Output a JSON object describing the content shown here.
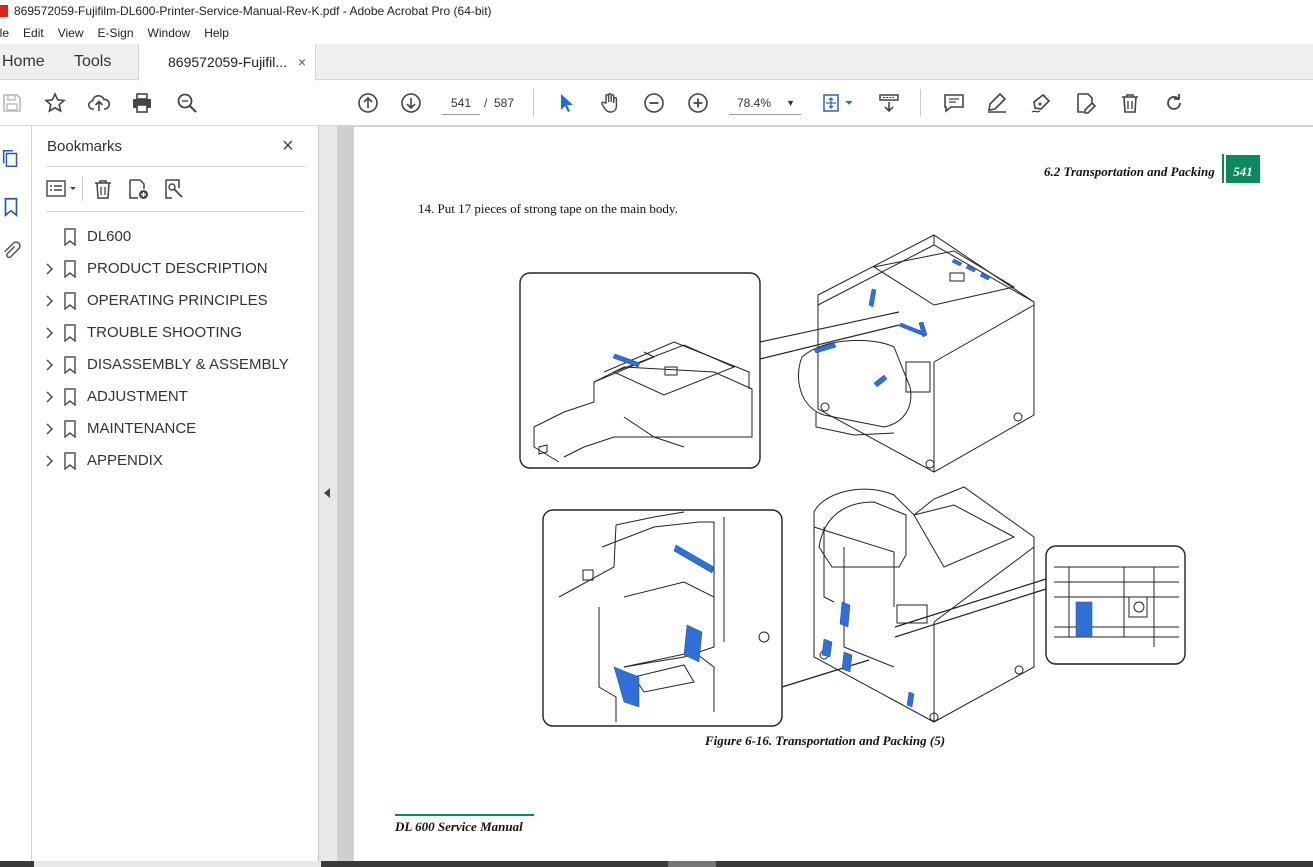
{
  "window": {
    "title": "869572059-Fujifilm-DL600-Printer-Service-Manual-Rev-K.pdf - Adobe Acrobat Pro (64-bit)"
  },
  "menu": [
    "ile",
    "Edit",
    "View",
    "E-Sign",
    "Window",
    "Help"
  ],
  "tabs": {
    "home": "Home",
    "tools": "Tools",
    "document": "869572059-Fujifil...",
    "close": "×"
  },
  "toolbar": {
    "page_current": "541",
    "page_separator": "/",
    "page_total": "587",
    "zoom": "78.4%"
  },
  "bookmarks": {
    "title": "Bookmarks",
    "close": "×",
    "items": [
      {
        "label": "DL600",
        "expandable": false
      },
      {
        "label": "PRODUCT DESCRIPTION",
        "expandable": true
      },
      {
        "label": "OPERATING PRINCIPLES",
        "expandable": true
      },
      {
        "label": "TROUBLE SHOOTING",
        "expandable": true
      },
      {
        "label": "DISASSEMBLY & ASSEMBLY",
        "expandable": true
      },
      {
        "label": "ADJUSTMENT",
        "expandable": true
      },
      {
        "label": "MAINTENANCE",
        "expandable": true
      },
      {
        "label": "APPENDIX",
        "expandable": true
      }
    ]
  },
  "page": {
    "header_section": "6.2 Transportation and Packing",
    "header_page": "541",
    "step": "14.  Put 17 pieces of strong tape on the main body.",
    "caption": "Figure 6-16.  Transportation and Packing (5)",
    "footer": "DL 600 Service Manual"
  },
  "colors": {
    "accent_green": "#0b8a5c",
    "tape_blue": "#2f6fd6",
    "pointer_blue": "#1f6fd0"
  }
}
